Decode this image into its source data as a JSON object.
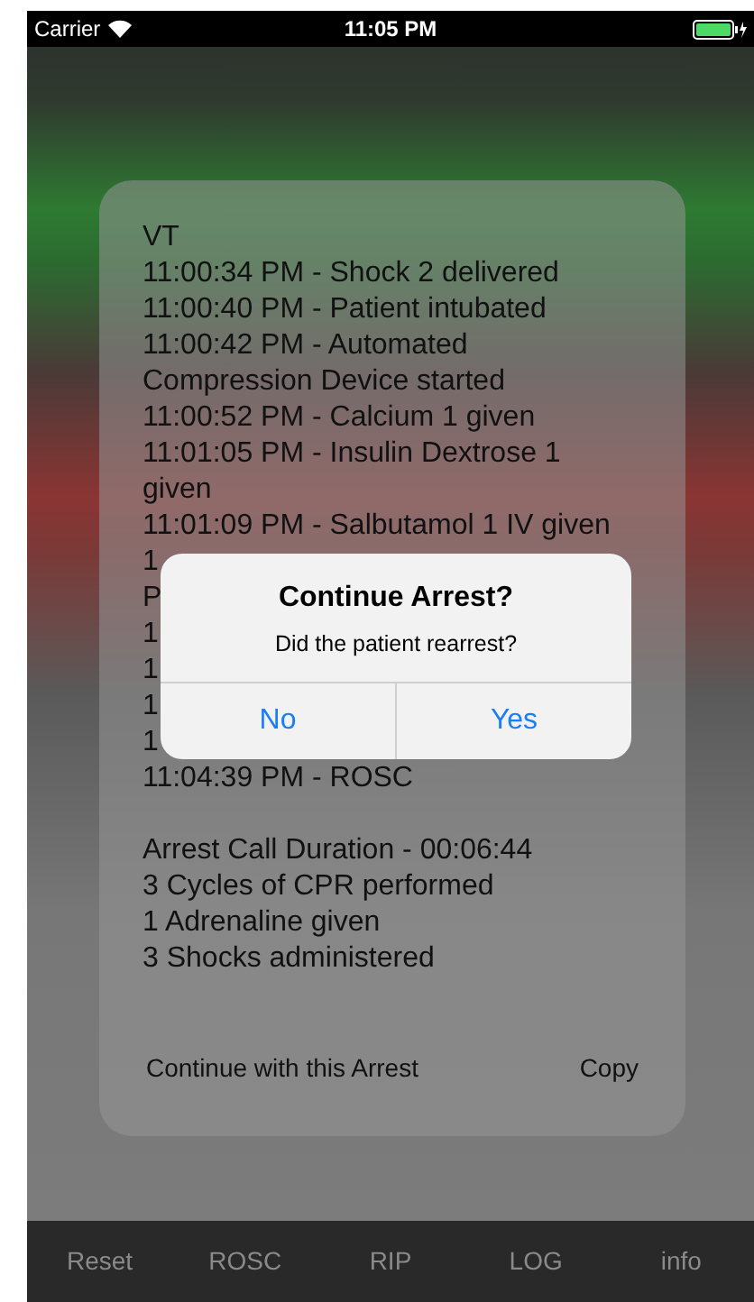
{
  "status_bar": {
    "carrier": "Carrier",
    "time": "11:05 PM"
  },
  "log": {
    "lines": [
      "VT",
      "11:00:34 PM - Shock 2 delivered",
      "11:00:40 PM - Patient intubated",
      "11:00:42 PM - Automated Compression Device started",
      "11:00:52 PM - Calcium 1 given",
      "11:01:05 PM - Insulin Dextrose 1 given",
      "11:01:09 PM - Salbutamol 1 IV given",
      "1",
      "P",
      "1",
      "1",
      "1",
      "1",
      "11:04:39 PM - ROSC"
    ],
    "summary": [
      "Arrest Call Duration - 00:06:44",
      "3 Cycles of CPR performed",
      "1 Adrenaline given",
      "3 Shocks administered"
    ],
    "buttons": [
      "Continue with this Arrest",
      "Copy"
    ]
  },
  "alert": {
    "title": "Continue Arrest?",
    "message": "Did the patient rearrest?",
    "buttons": [
      "No",
      "Yes"
    ]
  },
  "tab_bar": [
    "Reset",
    "ROSC",
    "RIP",
    "LOG",
    "info"
  ]
}
